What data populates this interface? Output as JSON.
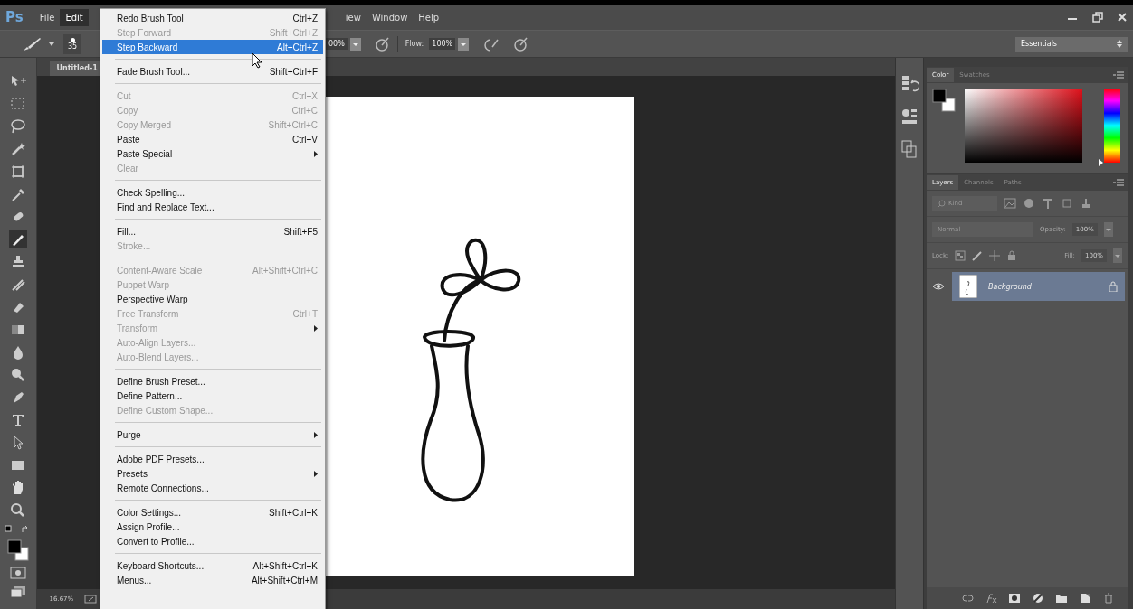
{
  "menubar": {
    "logo": "Ps",
    "items": [
      {
        "label": "File",
        "selected": false
      },
      {
        "label": "Edit",
        "selected": true
      },
      {
        "label": "iew",
        "selected": false
      },
      {
        "label": "Window",
        "selected": false
      },
      {
        "label": "Help",
        "selected": false
      }
    ]
  },
  "options_bar": {
    "brush_size": "35",
    "opacity": "00%",
    "flow_label": "Flow:",
    "flow": "100%",
    "workspace": "Essentials"
  },
  "document": {
    "tab": "Untitled-1",
    "zoom": "16.67%"
  },
  "color_panel": {
    "tabs": [
      {
        "label": "Color",
        "selected": true
      },
      {
        "label": "Swatches",
        "selected": false
      }
    ],
    "hue_slider": {
      "level": 0
    }
  },
  "layers_panel": {
    "tabs": [
      {
        "label": "Layers",
        "selected": true
      },
      {
        "label": "Channels",
        "selected": false
      },
      {
        "label": "Paths",
        "selected": false
      }
    ],
    "filter": "Kind",
    "blend_mode": "Normal",
    "opacity_label": "Opacity:",
    "opacity": "100%",
    "lock_label": "Lock:",
    "fill_label": "Fill:",
    "fill": "100%",
    "layers": [
      {
        "name": "Background",
        "selected": true,
        "visible": true,
        "locked": true
      }
    ]
  },
  "edit_menu": {
    "items": [
      {
        "kind": "item",
        "label": "Redo Brush Tool",
        "shortcut": "Ctrl+Z",
        "disabled": false,
        "selected": false,
        "submenu": false
      },
      {
        "kind": "item",
        "label": "Step Forward",
        "shortcut": "Shift+Ctrl+Z",
        "disabled": true,
        "selected": false,
        "submenu": false
      },
      {
        "kind": "item",
        "label": "Step Backward",
        "shortcut": "Alt+Ctrl+Z",
        "disabled": false,
        "selected": true,
        "submenu": false
      },
      {
        "kind": "separator"
      },
      {
        "kind": "item",
        "label": "Fade Brush Tool...",
        "shortcut": "Shift+Ctrl+F",
        "disabled": false,
        "selected": false,
        "submenu": false
      },
      {
        "kind": "separator"
      },
      {
        "kind": "item",
        "label": "Cut",
        "shortcut": "Ctrl+X",
        "disabled": true,
        "selected": false,
        "submenu": false
      },
      {
        "kind": "item",
        "label": "Copy",
        "shortcut": "Ctrl+C",
        "disabled": true,
        "selected": false,
        "submenu": false
      },
      {
        "kind": "item",
        "label": "Copy Merged",
        "shortcut": "Shift+Ctrl+C",
        "disabled": true,
        "selected": false,
        "submenu": false
      },
      {
        "kind": "item",
        "label": "Paste",
        "shortcut": "Ctrl+V",
        "disabled": false,
        "selected": false,
        "submenu": false
      },
      {
        "kind": "item",
        "label": "Paste Special",
        "disabled": false,
        "selected": false,
        "submenu": true
      },
      {
        "kind": "item",
        "label": "Clear",
        "disabled": true,
        "selected": false,
        "submenu": false
      },
      {
        "kind": "separator"
      },
      {
        "kind": "item",
        "label": "Check Spelling...",
        "disabled": false,
        "selected": false,
        "submenu": false
      },
      {
        "kind": "item",
        "label": "Find and Replace Text...",
        "disabled": false,
        "selected": false,
        "submenu": false
      },
      {
        "kind": "separator"
      },
      {
        "kind": "item",
        "label": "Fill...",
        "shortcut": "Shift+F5",
        "disabled": false,
        "selected": false,
        "submenu": false
      },
      {
        "kind": "item",
        "label": "Stroke...",
        "disabled": true,
        "selected": false,
        "submenu": false
      },
      {
        "kind": "separator"
      },
      {
        "kind": "item",
        "label": "Content-Aware Scale",
        "shortcut": "Alt+Shift+Ctrl+C",
        "disabled": true,
        "selected": false,
        "submenu": false
      },
      {
        "kind": "item",
        "label": "Puppet Warp",
        "disabled": true,
        "selected": false,
        "submenu": false
      },
      {
        "kind": "item",
        "label": "Perspective Warp",
        "disabled": false,
        "selected": false,
        "submenu": false
      },
      {
        "kind": "item",
        "label": "Free Transform",
        "shortcut": "Ctrl+T",
        "disabled": true,
        "selected": false,
        "submenu": false
      },
      {
        "kind": "item",
        "label": "Transform",
        "disabled": true,
        "selected": false,
        "submenu": true
      },
      {
        "kind": "item",
        "label": "Auto-Align Layers...",
        "disabled": true,
        "selected": false,
        "submenu": false
      },
      {
        "kind": "item",
        "label": "Auto-Blend Layers...",
        "disabled": true,
        "selected": false,
        "submenu": false
      },
      {
        "kind": "separator"
      },
      {
        "kind": "item",
        "label": "Define Brush Preset...",
        "disabled": false,
        "selected": false,
        "submenu": false
      },
      {
        "kind": "item",
        "label": "Define Pattern...",
        "disabled": false,
        "selected": false,
        "submenu": false
      },
      {
        "kind": "item",
        "label": "Define Custom Shape...",
        "disabled": true,
        "selected": false,
        "submenu": false
      },
      {
        "kind": "separator"
      },
      {
        "kind": "item",
        "label": "Purge",
        "disabled": false,
        "selected": false,
        "submenu": true
      },
      {
        "kind": "separator"
      },
      {
        "kind": "item",
        "label": "Adobe PDF Presets...",
        "disabled": false,
        "selected": false,
        "submenu": false
      },
      {
        "kind": "item",
        "label": "Presets",
        "disabled": false,
        "selected": false,
        "submenu": true
      },
      {
        "kind": "item",
        "label": "Remote Connections...",
        "disabled": false,
        "selected": false,
        "submenu": false
      },
      {
        "kind": "separator"
      },
      {
        "kind": "item",
        "label": "Color Settings...",
        "shortcut": "Shift+Ctrl+K",
        "disabled": false,
        "selected": false,
        "submenu": false
      },
      {
        "kind": "item",
        "label": "Assign Profile...",
        "disabled": false,
        "selected": false,
        "submenu": false
      },
      {
        "kind": "item",
        "label": "Convert to Profile...",
        "disabled": false,
        "selected": false,
        "submenu": false
      },
      {
        "kind": "separator"
      },
      {
        "kind": "item",
        "label": "Keyboard Shortcuts...",
        "shortcut": "Alt+Shift+Ctrl+K",
        "disabled": false,
        "selected": false,
        "submenu": false
      },
      {
        "kind": "item",
        "label": "Menus...",
        "shortcut": "Alt+Shift+Ctrl+M",
        "disabled": false,
        "selected": false,
        "submenu": false
      }
    ]
  }
}
